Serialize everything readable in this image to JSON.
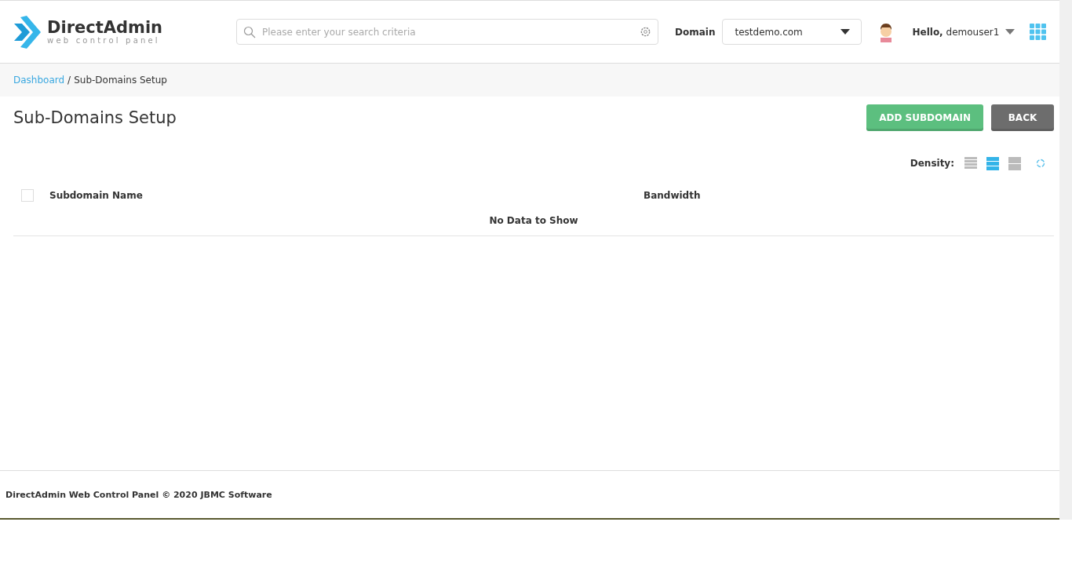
{
  "header": {
    "logo_title": "DirectAdmin",
    "logo_subtitle": "web control panel",
    "search": {
      "placeholder": "Please enter your search criteria"
    },
    "domain_label": "Domain",
    "domain_value": "testdemo.com",
    "greeting": "Hello,",
    "username": "demouser1"
  },
  "breadcrumb": [
    {
      "label": "Dashboard",
      "link": true
    },
    {
      "label": "/",
      "kind": "separator"
    },
    {
      "label": "Sub-Domains Setup",
      "link": false
    }
  ],
  "page_title": "Sub-Domains Setup",
  "buttons": [
    {
      "label": "ADD SUBDOMAIN",
      "kind": "primary"
    },
    {
      "label": "BACK",
      "kind": "secondary"
    }
  ],
  "density": {
    "label": "Density:",
    "options": [
      {
        "kind": "compact",
        "selected": false
      },
      {
        "kind": "normal",
        "selected": true
      },
      {
        "kind": "large",
        "selected": false
      }
    ]
  },
  "table": {
    "select_all_checked": false,
    "columns": [
      "Subdomain Name",
      "Bandwidth"
    ],
    "empty_message": "No Data to Show"
  },
  "footer": "DirectAdmin Web Control Panel © 2020 JBMC Software"
}
